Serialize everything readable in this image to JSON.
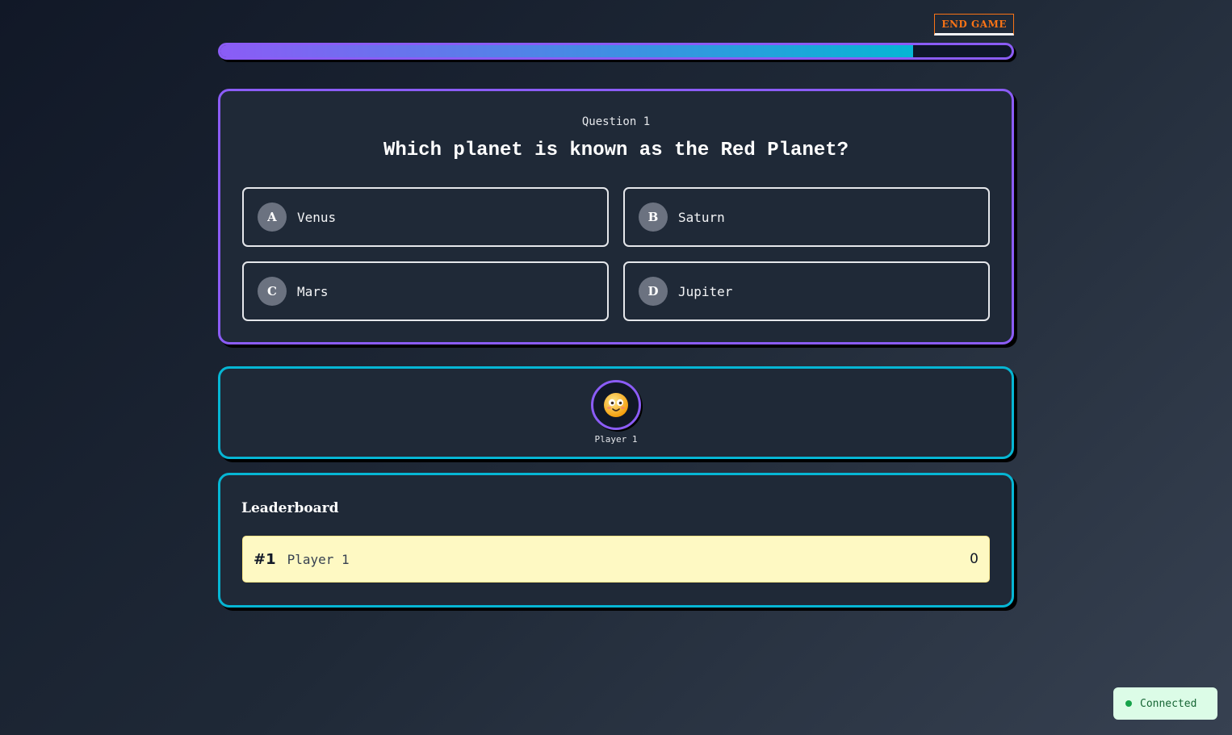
{
  "header": {
    "end_game_label": "END GAME"
  },
  "progress": {
    "fraction": 0.875
  },
  "question": {
    "number_label": "Question 1",
    "text": "Which planet is known as the Red Planet?",
    "options": [
      {
        "letter": "A",
        "text": "Venus"
      },
      {
        "letter": "B",
        "text": "Saturn"
      },
      {
        "letter": "C",
        "text": "Mars"
      },
      {
        "letter": "D",
        "text": "Jupiter"
      }
    ]
  },
  "players": [
    {
      "name": "Player 1",
      "avatar_icon": "smiling-face-icon"
    }
  ],
  "leaderboard": {
    "title": "Leaderboard",
    "rows": [
      {
        "rank": "#1",
        "name": "Player 1",
        "score": "0"
      }
    ]
  },
  "connection": {
    "status_label": "Connected"
  },
  "colors": {
    "accent_purple": "#8b5cf6",
    "accent_cyan": "#06b6d4",
    "end_game_orange": "#f97316",
    "leaderboard_highlight": "#fef9c3",
    "connected_green": "#16a34a"
  }
}
